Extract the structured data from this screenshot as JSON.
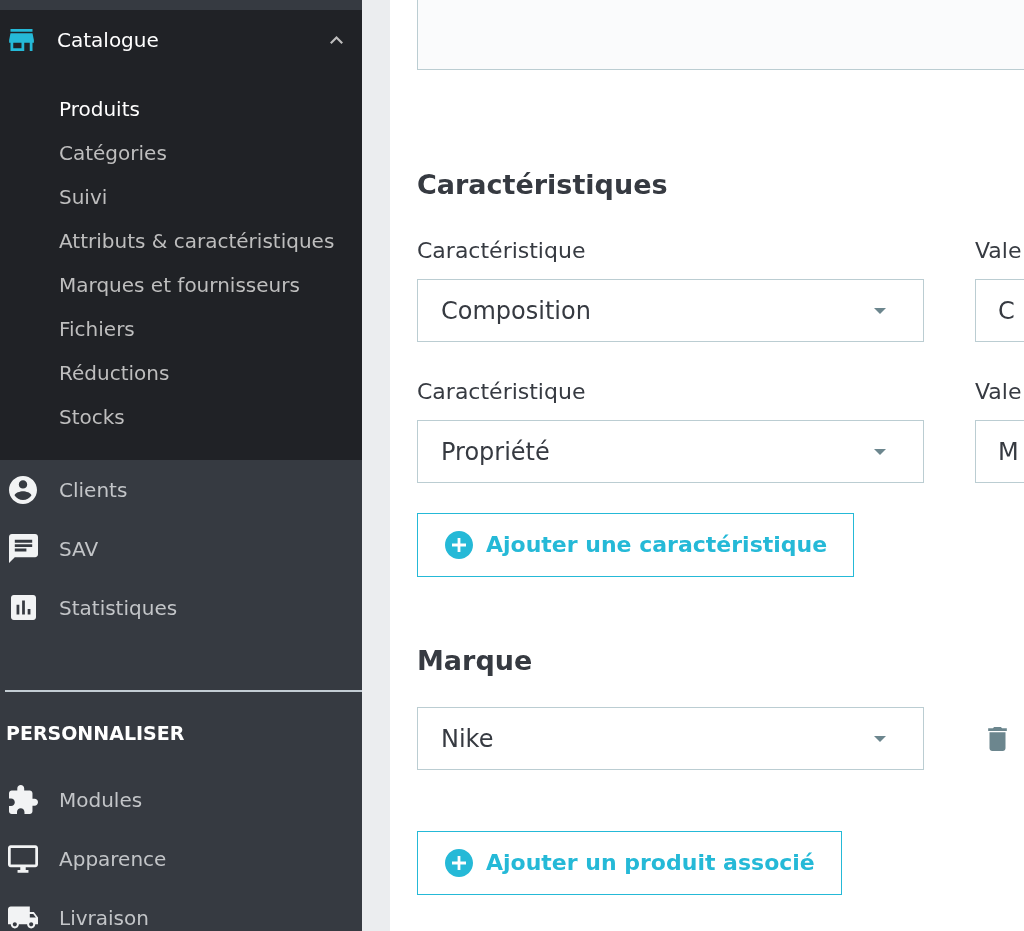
{
  "sidebar": {
    "catalogue": {
      "label": "Catalogue",
      "expanded": true,
      "children": [
        {
          "label": "Produits",
          "selected": true
        },
        {
          "label": "Catégories",
          "selected": false
        },
        {
          "label": "Suivi",
          "selected": false
        },
        {
          "label": "Attributs & caractéristiques",
          "selected": false
        },
        {
          "label": "Marques et fournisseurs",
          "selected": false
        },
        {
          "label": "Fichiers",
          "selected": false
        },
        {
          "label": "Réductions",
          "selected": false
        },
        {
          "label": "Stocks",
          "selected": false
        }
      ]
    },
    "items": [
      {
        "label": "Clients"
      },
      {
        "label": "SAV"
      },
      {
        "label": "Statistiques"
      }
    ],
    "section_title": "PERSONNALISER",
    "section_items": [
      {
        "label": "Modules"
      },
      {
        "label": "Apparence"
      },
      {
        "label": "Livraison"
      }
    ]
  },
  "features": {
    "title": "Caractéristiques",
    "rows": [
      {
        "label": "Caractéristique",
        "value": "Composition",
        "value_label": "Vale",
        "value_value": "C"
      },
      {
        "label": "Caractéristique",
        "value": "Propriété",
        "value_label": "Vale",
        "value_value": "M"
      }
    ],
    "add_button": "Ajouter une caractéristique"
  },
  "brand": {
    "title": "Marque",
    "value": "Nike"
  },
  "add_related_button": "Ajouter un produit associé"
}
